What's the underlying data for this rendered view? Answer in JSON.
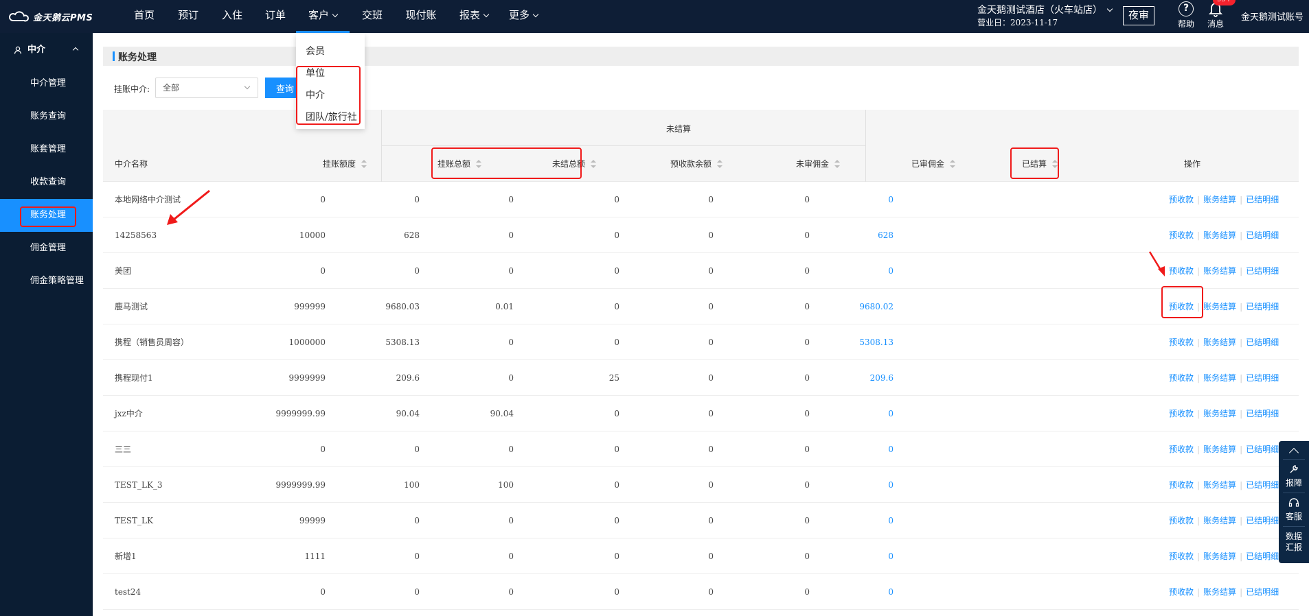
{
  "brand": {
    "logo_text": "金天鹅云PMS"
  },
  "nav": {
    "items": [
      {
        "label": "首页",
        "dropdown": false
      },
      {
        "label": "预订",
        "dropdown": false
      },
      {
        "label": "入住",
        "dropdown": false
      },
      {
        "label": "订单",
        "dropdown": false
      },
      {
        "label": "客户",
        "dropdown": true,
        "active": true
      },
      {
        "label": "交班",
        "dropdown": false
      },
      {
        "label": "现付账",
        "dropdown": false
      },
      {
        "label": "报表",
        "dropdown": true
      },
      {
        "label": "更多",
        "dropdown": true
      }
    ],
    "hotel_name": "金天鹅测试酒店（火车站店）",
    "business_date": "营业日：2023-11-17",
    "night_audit": "夜审",
    "help": "帮助",
    "messages": "消息",
    "message_badge": "99+",
    "account": "金天鹅测试账号"
  },
  "customer_menu": {
    "items": [
      "会员",
      "单位",
      "中介",
      "团队/旅行社"
    ]
  },
  "sidebar": {
    "section": "中介",
    "items": [
      {
        "label": "中介管理"
      },
      {
        "label": "账务查询"
      },
      {
        "label": "账套管理"
      },
      {
        "label": "收款查询"
      },
      {
        "label": "账务处理",
        "active": true
      },
      {
        "label": "佣金管理"
      },
      {
        "label": "佣金策略管理"
      }
    ]
  },
  "page": {
    "title": "账务处理",
    "filter_label": "挂账中介:",
    "filter_value": "全部",
    "query_button": "查询"
  },
  "table": {
    "group_header": "未结算",
    "columns": {
      "name": "中介名称",
      "credit_limit": "挂账额度",
      "credit_total": "挂账总额",
      "unsettled_total": "未结总额",
      "prepaid_balance": "预收款余额",
      "pending_commission": "未审佣金",
      "approved_commission": "已审佣金",
      "settled": "已结算",
      "actions": "操作"
    },
    "action_labels": {
      "prepay": "预收款",
      "settle": "账务结算",
      "settled_detail": "已结明细"
    },
    "rows": [
      {
        "name": "本地网络中介测试",
        "credit_limit": "0",
        "credit_total": "0",
        "unsettled_total": "0",
        "prepaid_balance": "0",
        "pending_commission": "0",
        "approved_commission": "0",
        "settled": "0"
      },
      {
        "name": "14258563",
        "credit_limit": "10000",
        "credit_total": "628",
        "unsettled_total": "0",
        "prepaid_balance": "0",
        "pending_commission": "0",
        "approved_commission": "0",
        "settled": "628"
      },
      {
        "name": "美团",
        "credit_limit": "0",
        "credit_total": "0",
        "unsettled_total": "0",
        "prepaid_balance": "0",
        "pending_commission": "0",
        "approved_commission": "0",
        "settled": "0"
      },
      {
        "name": "鹿马测试",
        "credit_limit": "999999",
        "credit_total": "9680.03",
        "unsettled_total": "0.01",
        "prepaid_balance": "0",
        "pending_commission": "0",
        "approved_commission": "0",
        "settled": "9680.02"
      },
      {
        "name": "携程（销售员周容）",
        "credit_limit": "1000000",
        "credit_total": "5308.13",
        "unsettled_total": "0",
        "prepaid_balance": "0",
        "pending_commission": "0",
        "approved_commission": "0",
        "settled": "5308.13"
      },
      {
        "name": "携程现付1",
        "credit_limit": "9999999",
        "credit_total": "209.6",
        "unsettled_total": "0",
        "prepaid_balance": "25",
        "pending_commission": "0",
        "approved_commission": "0",
        "settled": "209.6"
      },
      {
        "name": "jxz中介",
        "credit_limit": "9999999.99",
        "credit_total": "90.04",
        "unsettled_total": "90.04",
        "prepaid_balance": "0",
        "pending_commission": "0",
        "approved_commission": "0",
        "settled": "0"
      },
      {
        "name": "三三",
        "credit_limit": "0",
        "credit_total": "0",
        "unsettled_total": "0",
        "prepaid_balance": "0",
        "pending_commission": "0",
        "approved_commission": "0",
        "settled": "0"
      },
      {
        "name": "TEST_LK_3",
        "credit_limit": "9999999.99",
        "credit_total": "100",
        "unsettled_total": "100",
        "prepaid_balance": "0",
        "pending_commission": "0",
        "approved_commission": "0",
        "settled": "0"
      },
      {
        "name": "TEST_LK",
        "credit_limit": "99999",
        "credit_total": "0",
        "unsettled_total": "0",
        "prepaid_balance": "0",
        "pending_commission": "0",
        "approved_commission": "0",
        "settled": "0"
      },
      {
        "name": "新增1",
        "credit_limit": "1111",
        "credit_total": "0",
        "unsettled_total": "0",
        "prepaid_balance": "0",
        "pending_commission": "0",
        "approved_commission": "0",
        "settled": "0"
      },
      {
        "name": "test24",
        "credit_limit": "0",
        "credit_total": "0",
        "unsettled_total": "0",
        "prepaid_balance": "0",
        "pending_commission": "0",
        "approved_commission": "0",
        "settled": "0"
      }
    ]
  },
  "float_tools": {
    "report_issue": "报障",
    "service": "客服",
    "data_report_1": "数据",
    "data_report_2": "汇报"
  },
  "colors": {
    "navbar": "#0e1e36",
    "sidebar": "#0b1d33",
    "accent": "#1890ff",
    "highlight": "#f01a1a"
  }
}
